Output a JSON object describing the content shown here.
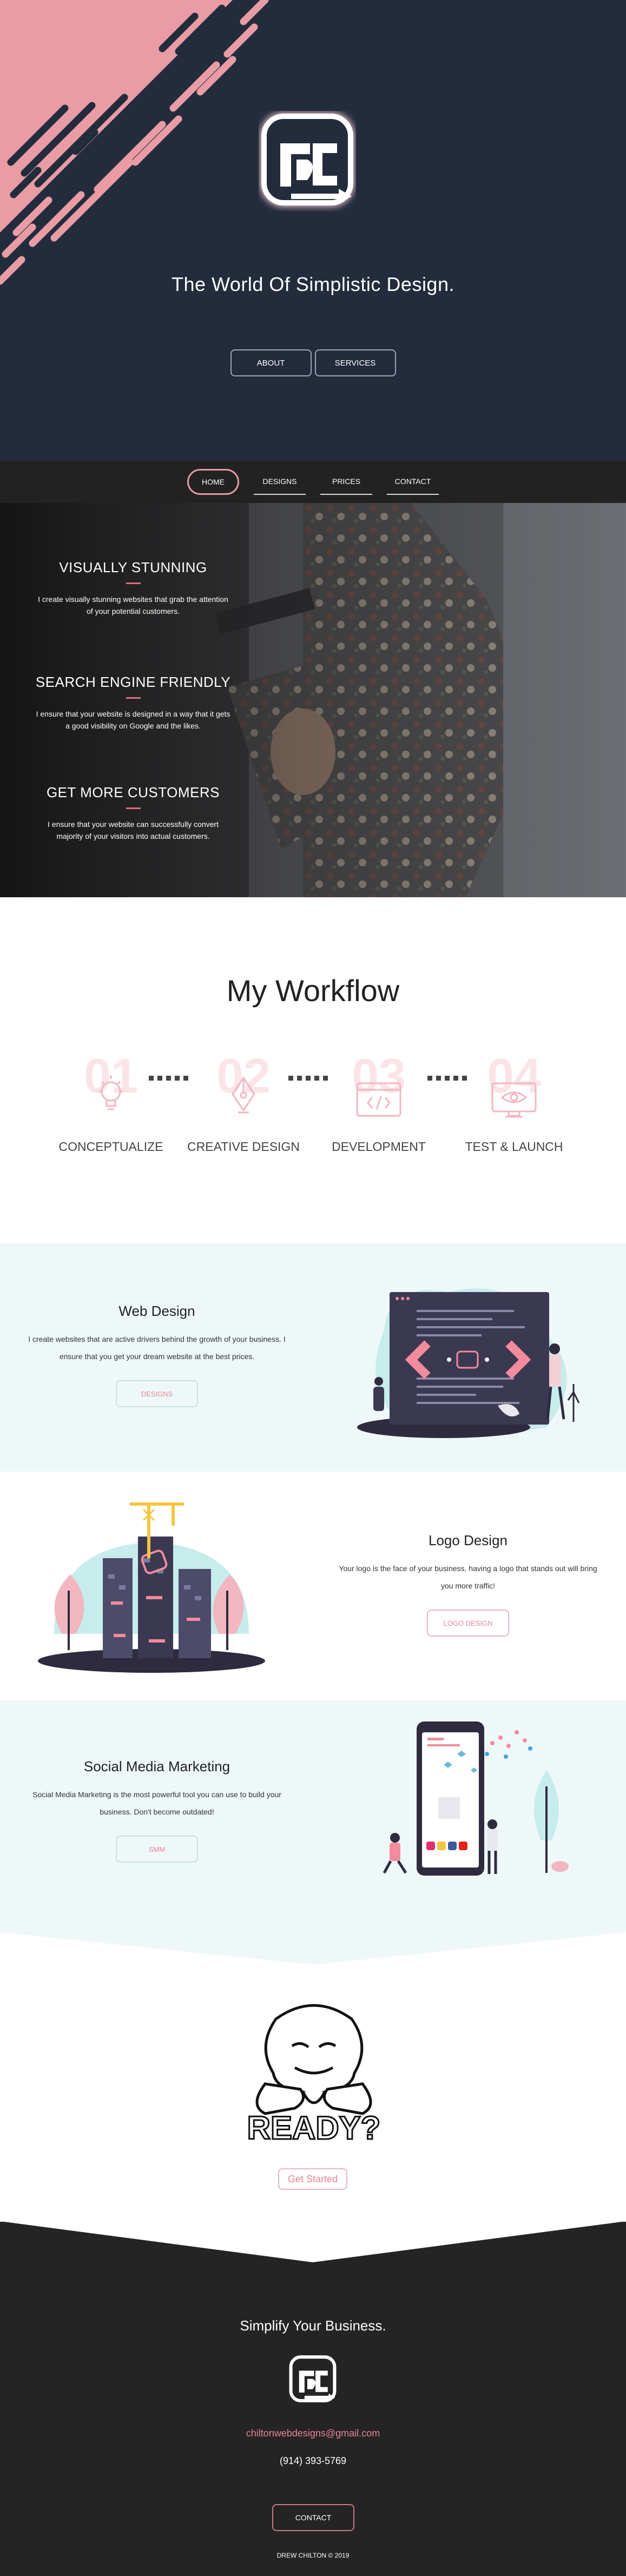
{
  "hero": {
    "tagline": "The World Of Simplistic Design.",
    "buttons": [
      "ABOUT",
      "SERVICES"
    ]
  },
  "nav": {
    "items": [
      "HOME",
      "DESIGNS",
      "PRICES",
      "CONTACT"
    ],
    "active": "HOME"
  },
  "features": [
    {
      "title": "VISUALLY STUNNING",
      "text": "I create visually stunning websites that grab the attention of your potential customers."
    },
    {
      "title": "SEARCH ENGINE FRIENDLY",
      "text": "I ensure that your website is designed in a way that it gets a good visibility on Google and the likes."
    },
    {
      "title": "GET MORE CUSTOMERS",
      "text": "I ensure that your website can successfully convert majority of your visitors into actual customers."
    }
  ],
  "workflow": {
    "title": "My Workflow",
    "steps": [
      {
        "num": "01",
        "label": "CONCEPTUALIZE",
        "icon": "lightbulb-icon"
      },
      {
        "num": "02",
        "label": "CREATIVE DESIGN",
        "icon": "pen-nib-icon"
      },
      {
        "num": "03",
        "label": "DEVELOPMENT",
        "icon": "code-window-icon"
      },
      {
        "num": "04",
        "label": "TEST & LAUNCH",
        "icon": "monitor-eye-icon"
      }
    ]
  },
  "services": [
    {
      "title": "Web Design",
      "text": "I create websites that are active drivers behind the growth of your business. I ensure that you get your dream website at the best prices.",
      "button": "DESIGNS"
    },
    {
      "title": "Logo Design",
      "text": "Your logo is the face of your business, having a logo that stands out will bring you more traffic!",
      "button": "LOGO DESIGN"
    },
    {
      "title": "Social Media Marketing",
      "text": "Social Media Marketing is the most powerful tool you can use to build your business. Don't become outdated!",
      "button": "SMM"
    }
  ],
  "ready": {
    "word": "READY?",
    "button": "Get Started"
  },
  "footer": {
    "title": "Simplify Your Business.",
    "email": "chiltonwebdesigns@gmail.com",
    "phone": "(914) 393-5769",
    "button": "CONTACT",
    "copyright": "DREW CHILTON © 2019"
  },
  "colors": {
    "navy": "#232c3d",
    "pink": "#e89aa4",
    "mint": "#eff8f9",
    "dark": "#242424"
  }
}
